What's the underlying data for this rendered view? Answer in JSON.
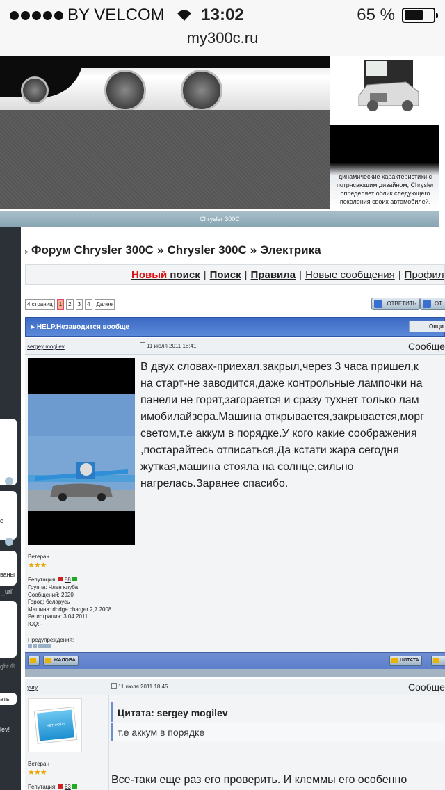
{
  "status_bar": {
    "carrier": "BY VELCOM",
    "time": "13:02",
    "battery_percent": "65 %",
    "battery_level": 0.65,
    "url": "my300c.ru"
  },
  "banner": {
    "caption": "динамические характеристики с потрясающим дизайном, Chrysler определяет облик следующего поколения своих автомобилей.",
    "nav_label": "Chrysler 300C"
  },
  "breadcrumb": {
    "forum": "Форум Chrysler 300C",
    "sep": "»",
    "section": "Chrysler 300C",
    "subsection": "Электрика"
  },
  "search_bar": {
    "new_label": "Новый",
    "search_label": "поиск",
    "search": "Поиск",
    "rules": "Правила",
    "new_messages": "Новые сообщения",
    "profile": "Профиль"
  },
  "pagination": {
    "total": "4 страниц",
    "pages": [
      "1",
      "2",
      "3",
      "4"
    ],
    "current": "1",
    "next": "Далее"
  },
  "buttons": {
    "reply": "ОТВЕТИТЬ",
    "reply2": "ОТ",
    "options": "Опци",
    "complain": "ЖАЛОБА",
    "quote": "ЦИТАТА"
  },
  "topic": {
    "title": "HELP.Незаводится вообще"
  },
  "post1": {
    "author": "sergey mogilev",
    "date": "11 июля 2011 18:41",
    "message_label": "Сообще",
    "text_lines": [
      "В двух словах-приехал,закрыл,через 3 часа пришел,к",
      "на старт-не заводится,даже контрольные лампочки на",
      "панели не горят,загорается и сразу тухнет только лам",
      "имобилайзера.Машина открывается,закрывается,морг",
      "светом,т.е аккум в порядке.У кого какие соображения",
      ",постарайтесь отписаться.Да кстати жара сегодня",
      "жуткая,машина стояла на солнце,сильно",
      "нагрелась.Заранее спасибо."
    ],
    "rank": "Ветеран",
    "stars": "★★★",
    "reputation_label": "Репутация:",
    "reputation_value": "88",
    "group": "Группа: Член клуба",
    "messages": "Сообщений: 2920",
    "city": "Город: беларусь",
    "car": "Машина: dodge charger 2,7 2008",
    "registered": "Регистрация: 3.04.2011",
    "icq": "ICQ:--",
    "warnings": "Предупреждения:"
  },
  "post2": {
    "author": "yury",
    "date": "11 июля 2011 18:45",
    "message_label": "Сообще",
    "quote_title": "Цитата: sergey mogilev",
    "quote_text": "т.е аккум в порядке",
    "avatar_text": "НЕТ ФОТО",
    "text": "Все-таки еще раз его проверить. И клеммы его особенно",
    "rank": "Ветеран",
    "stars": "★★★",
    "reputation_label": "Репутация:",
    "reputation_value": "63"
  },
  "sidebar": {
    "url_fragment": "_url]",
    "copyright_fragment": "ght ©",
    "letter_c": "с",
    "vany": "ваны",
    "btn": "ать",
    "lev": "lev!"
  }
}
